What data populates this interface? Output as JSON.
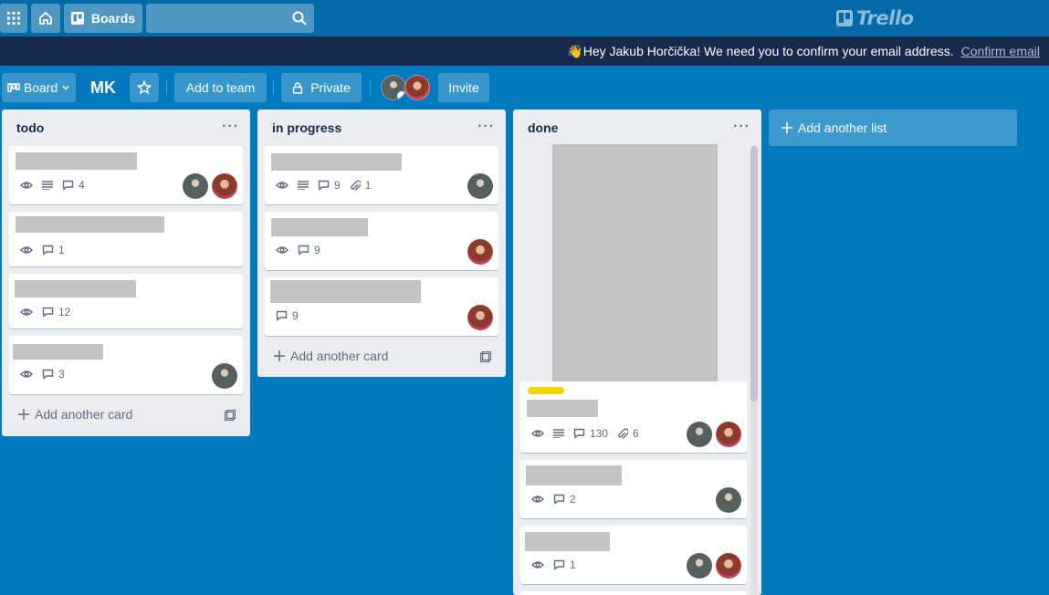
{
  "header": {
    "boards_label": "Boards",
    "search_placeholder": "",
    "logo_text": "Trello"
  },
  "banner": {
    "message": "👋Hey Jakub Horčička! We need you to confirm your email address.",
    "confirm_link": "Confirm email"
  },
  "board": {
    "view_label": "Board",
    "title": "MK",
    "add_to_team": "Add to team",
    "visibility": "Private",
    "invite": "Invite"
  },
  "lists": [
    {
      "title": "todo",
      "add_card": "Add another card",
      "cards": [
        {
          "comments": "4"
        },
        {
          "comments": "1"
        },
        {
          "comments": "12"
        },
        {
          "comments": "3"
        }
      ]
    },
    {
      "title": "in progress",
      "add_card": "Add another card",
      "cards": [
        {
          "comments": "9",
          "attachments": "1"
        },
        {
          "comments": "9"
        },
        {
          "comments": "9"
        }
      ]
    },
    {
      "title": "done",
      "cards": [
        {
          "comments": "130",
          "attachments": "6",
          "label_color": "#f2d600"
        },
        {
          "comments": "2"
        },
        {
          "comments": "1"
        }
      ]
    }
  ],
  "add_list": "Add another list",
  "colors": {
    "board_bg": "#0079bf",
    "header_bg": "#026aa7",
    "banner_bg": "#172b4d",
    "list_bg": "#ebecf0"
  }
}
